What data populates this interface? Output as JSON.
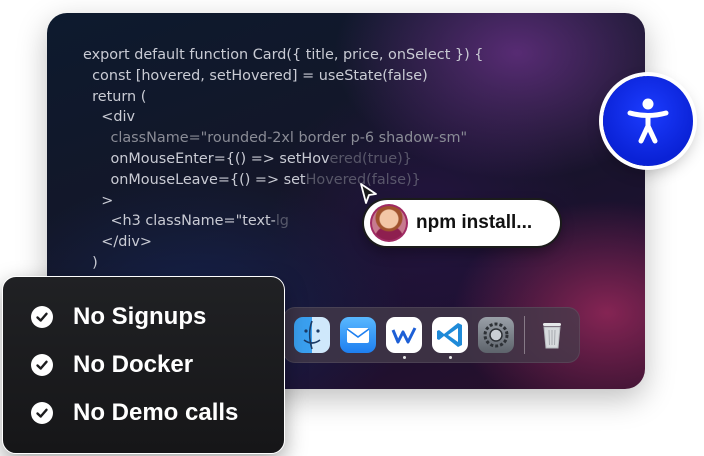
{
  "editor": {
    "lines": [
      "export default function Card({ title, price, onSelect }) {",
      "  const [hovered, setHovered] = useState(false)",
      "  return (",
      "    <div",
      "      className=\"rounded-2xl border p-6 shadow-sm\"",
      "      onMouseEnter={() => setHov",
      "      onMouseLeave={() => set",
      "    >",
      "      <h3 className=\"text-",
      "    </div>",
      "  )"
    ],
    "faded_tails": [
      "",
      "",
      "",
      "",
      "",
      "ered(true)}",
      "Hovered(false)}",
      "",
      "lg",
      "",
      ""
    ]
  },
  "presence_chip": {
    "text": "npm install..."
  },
  "dock": {
    "apps": [
      {
        "icon": "finder-icon"
      },
      {
        "icon": "mail-icon"
      },
      {
        "icon": "windsurf-icon"
      },
      {
        "icon": "vscode-icon"
      },
      {
        "icon": "system-settings-icon"
      },
      {
        "icon": "trash-icon"
      }
    ]
  },
  "features": [
    {
      "label": "No Signups"
    },
    {
      "label": "No Docker"
    },
    {
      "label": "No Demo calls"
    }
  ],
  "colors": {
    "accent_blue": "#0a22d6",
    "feature_panel": "#1b1b1d",
    "chip_bg": "#ffffff"
  }
}
